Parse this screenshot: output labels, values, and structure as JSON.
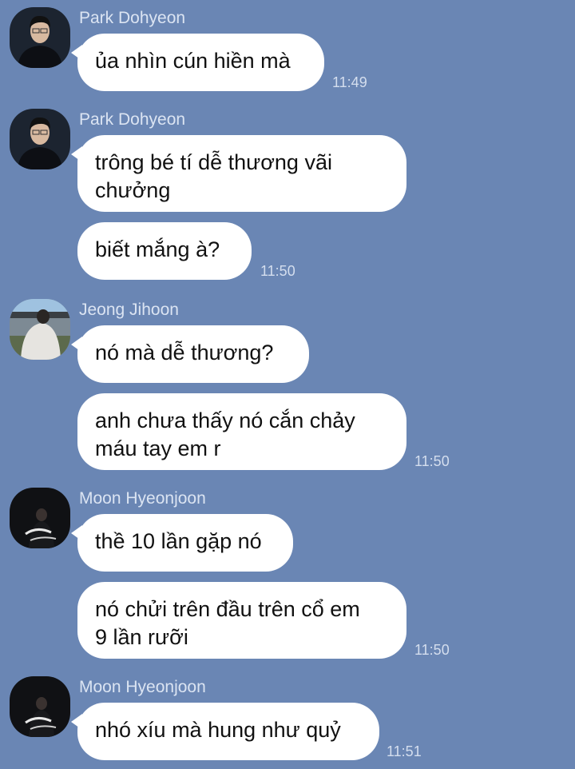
{
  "messages": [
    {
      "sender": "Park Dohyeon",
      "avatar": "avatar-park-dohyeon",
      "bubbles": [
        "ủa nhìn cún hiền mà"
      ],
      "time": "11:49"
    },
    {
      "sender": "Park Dohyeon",
      "avatar": "avatar-park-dohyeon",
      "bubbles": [
        "trông bé tí dễ thương vãi\nchưởng",
        "biết mắng à?"
      ],
      "time": "11:50"
    },
    {
      "sender": "Jeong Jihoon",
      "avatar": "avatar-jeong-jihoon",
      "bubbles": [
        "nó mà dễ thương?",
        "anh chưa thấy nó cắn chảy\nmáu tay em r"
      ],
      "time": "11:50"
    },
    {
      "sender": "Moon Hyeonjoon",
      "avatar": "avatar-moon-hyeonjoon",
      "bubbles": [
        "thề 10 lần gặp nó",
        "nó chửi trên đầu trên cổ em\n9 lần rưỡi"
      ],
      "time": "11:50"
    },
    {
      "sender": "Moon Hyeonjoon",
      "avatar": "avatar-moon-hyeonjoon",
      "bubbles": [
        "nhó xíu mà hung như quỷ"
      ],
      "time": "11:51"
    }
  ],
  "colors": {
    "background": "#6a86b4",
    "bubble": "#ffffff",
    "sender_text": "#dbe4f2",
    "time_text": "#d4deee"
  }
}
